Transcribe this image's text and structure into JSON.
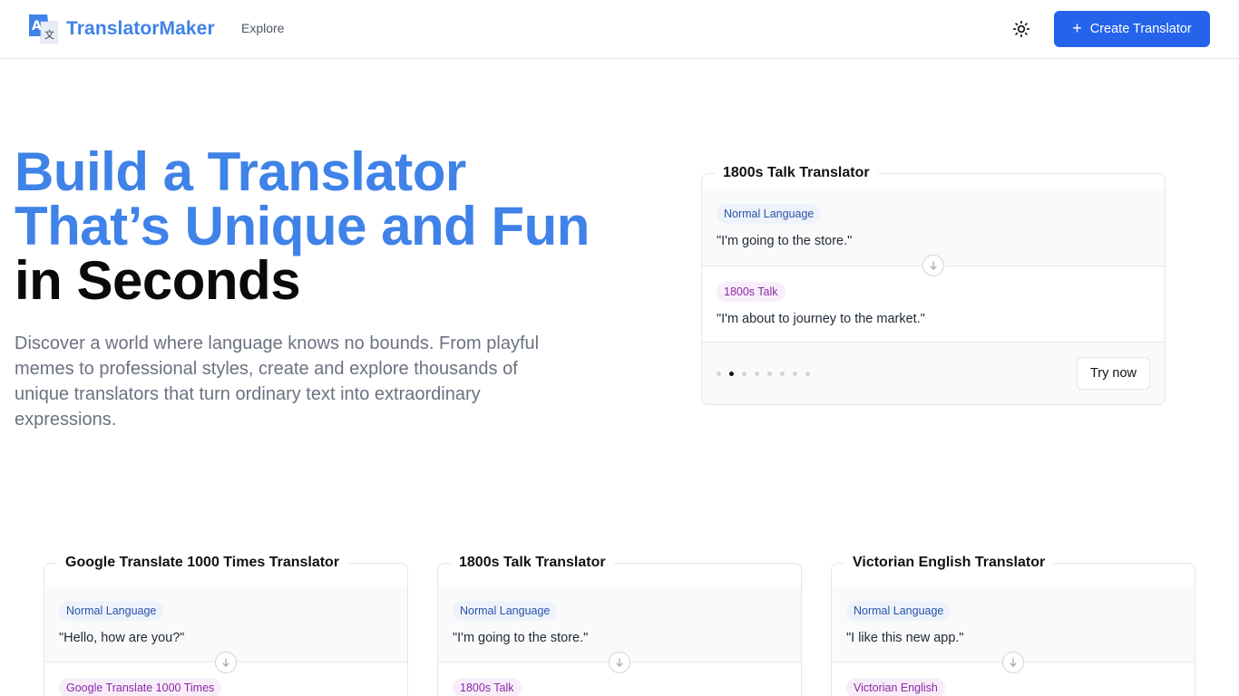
{
  "header": {
    "logo_text": "TranslatorMaker",
    "nav_explore": "Explore",
    "create_button": "Create Translator",
    "theme_icon": "sun-icon",
    "brand_color": "#3f82e8",
    "button_color": "#2563eb"
  },
  "hero": {
    "title_line1": "Build a Translator",
    "title_line2": "That’s Unique and Fun",
    "title_line3": "in Seconds",
    "description": "Discover a world where language knows no bounds. From playful memes to professional styles, create and explore thousands of unique translators that turn ordinary text into extraordinary expressions."
  },
  "featured": {
    "title": "1800s Talk Translator",
    "input_label": "Normal Language",
    "input_text": "\"I'm going to the store.\"",
    "output_label": "1800s Talk",
    "output_text": "\"I'm about to journey to the market.\"",
    "dot_count": 8,
    "active_dot": 1,
    "try_button": "Try now"
  },
  "cards": [
    {
      "title": "Google Translate 1000 Times Translator",
      "input_label": "Normal Language",
      "input_text": "\"Hello, how are you?\"",
      "output_label": "Google Translate 1000 Times"
    },
    {
      "title": "1800s Talk Translator",
      "input_label": "Normal Language",
      "input_text": "\"I'm going to the store.\"",
      "output_label": "1800s Talk"
    },
    {
      "title": "Victorian English Translator",
      "input_label": "Normal Language",
      "input_text": "\"I like this new app.\"",
      "output_label": "Victorian English"
    }
  ]
}
